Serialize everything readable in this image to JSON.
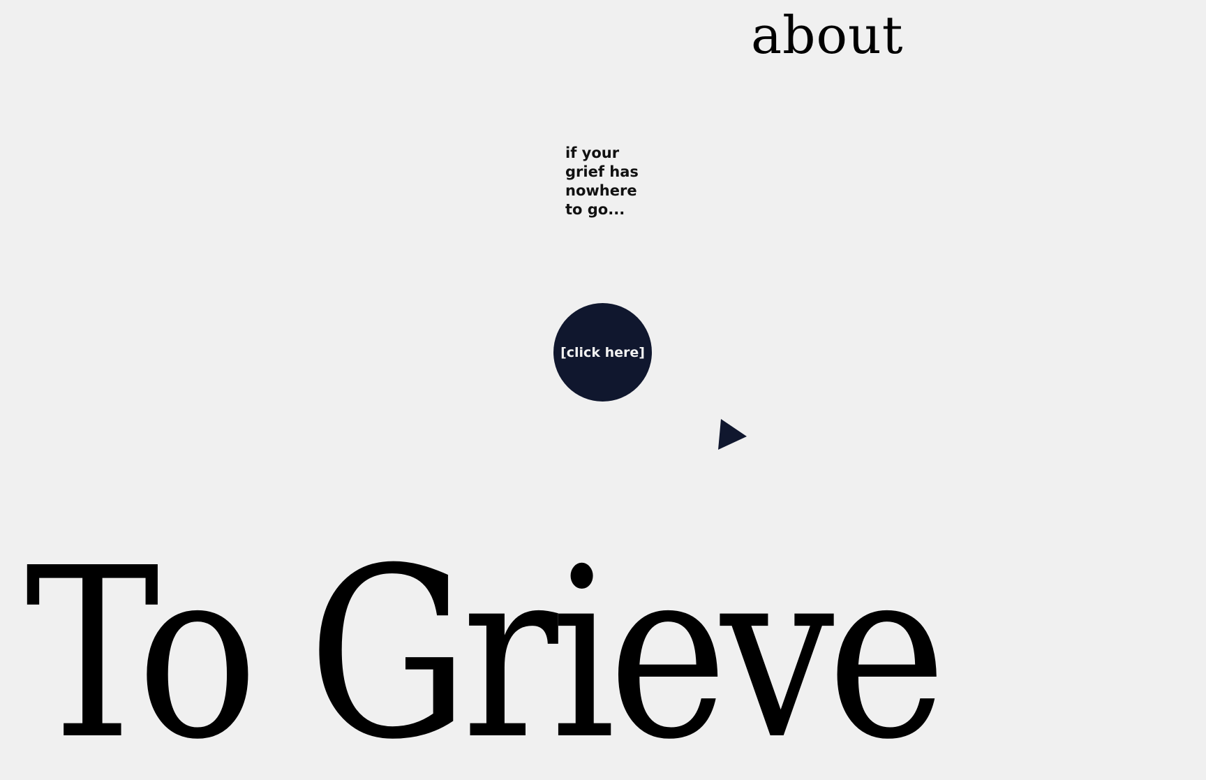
{
  "nav": {
    "about_label": "about"
  },
  "hero": {
    "tagline": "if your\ngrief has\nnowhere\nto go...",
    "cta_label": "[click here]",
    "title": "To Grieve"
  },
  "icons": {
    "cursor": "triangle-pointer-icon"
  },
  "colors": {
    "background": "#f0f0f0",
    "accent": "#10172e",
    "text": "#000000",
    "cta_text": "#f2f2f2"
  }
}
